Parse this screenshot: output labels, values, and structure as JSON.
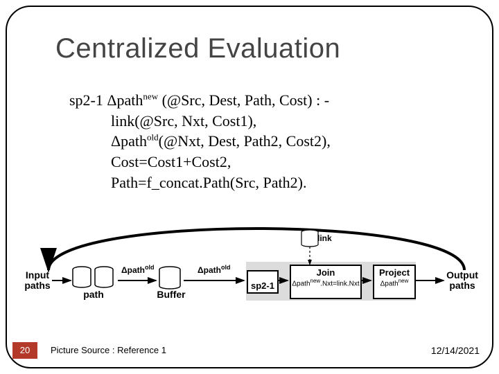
{
  "title": "Centralized Evaluation",
  "rule": {
    "l1a": "sp2-1 Δpath",
    "l1b": " (@Src,     Dest, Path, Cost) : -",
    "l2": "link(@Src, Nxt, Cost1),",
    "l3a": "Δpath",
    "l3b": "(@Nxt, Dest, Path2, Cost2),",
    "l4": "Cost=Cost1+Cost2,",
    "l5": "Path=f_concat.Path(Src, Path2).",
    "sup_new": "new",
    "sup_old": "old"
  },
  "diagram": {
    "input": "Input\npaths",
    "output": "Output\npaths",
    "path": "path",
    "buffer": "Buffer",
    "dpath_old": "Δpath",
    "dpath_old_sup": "old",
    "sp21": "sp2-1",
    "link": "link",
    "join": "Join",
    "join_sub_a": "Δpath",
    "join_sub_new": "new",
    "join_sub_b": ".Nxt=link.Nxt",
    "project": "Project",
    "project_sub_a": "Δpath",
    "project_sub_new": "new"
  },
  "footer": {
    "page": "20",
    "source": "Picture Source : Reference 1",
    "date": "12/14/2021"
  }
}
